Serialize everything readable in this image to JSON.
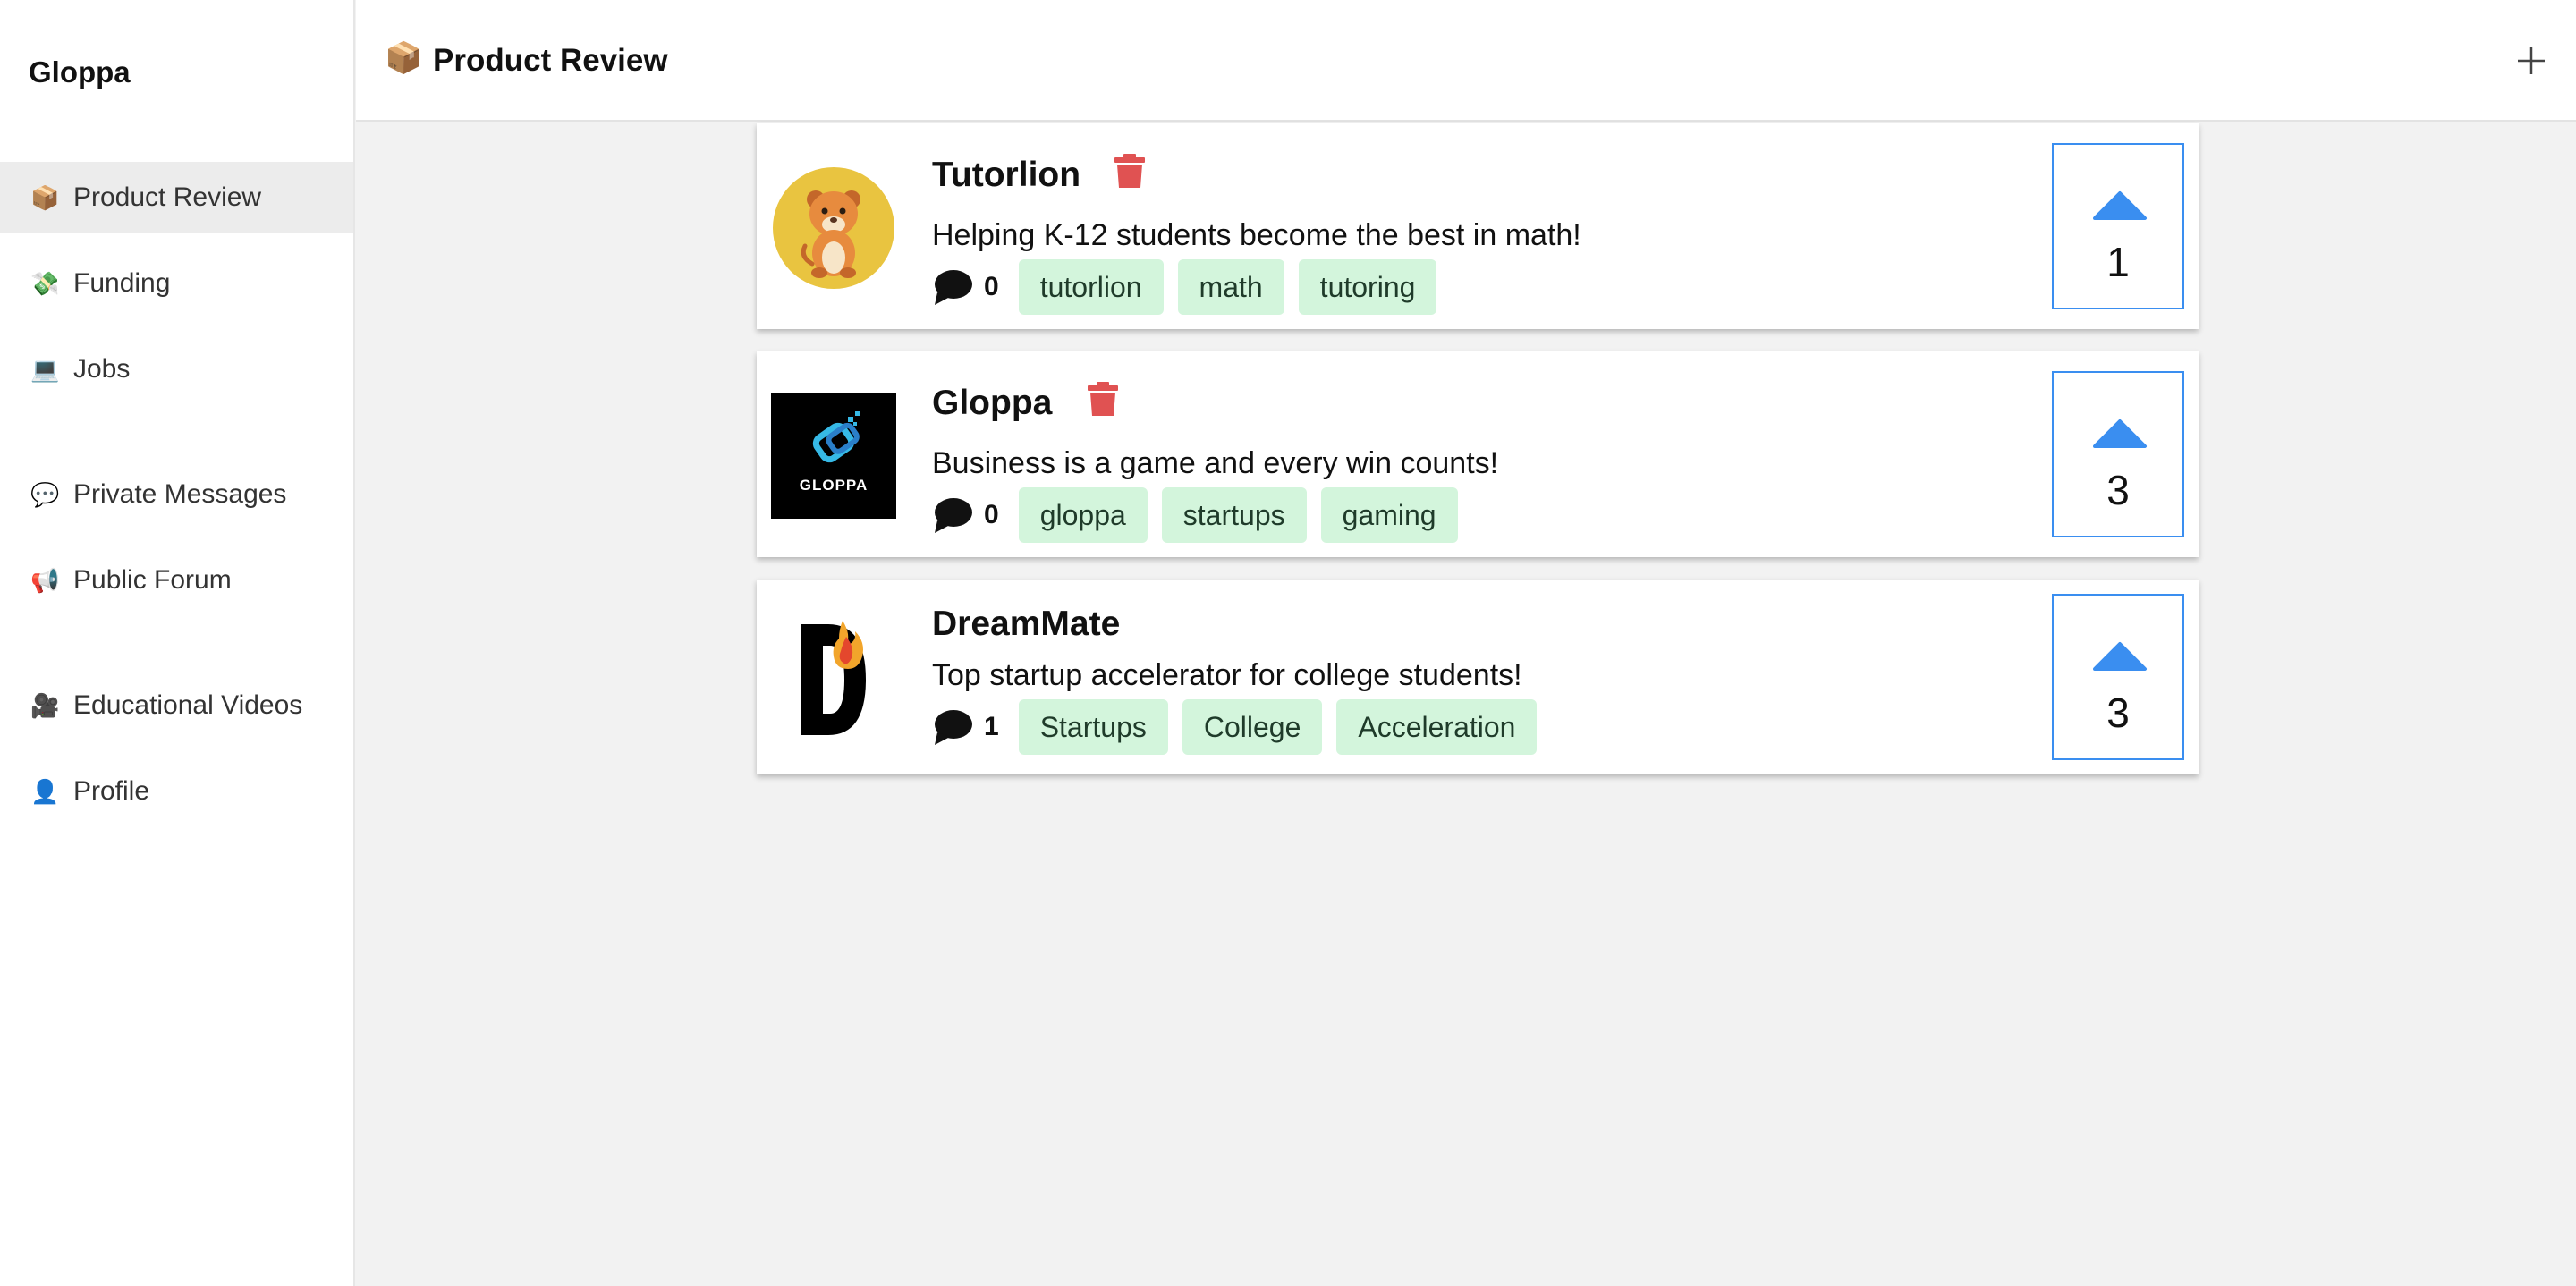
{
  "app": {
    "name": "Gloppa"
  },
  "sidebar": {
    "items": [
      {
        "emoji": "📦",
        "label": "Product Review",
        "active": true
      },
      {
        "emoji": "💸",
        "label": "Funding"
      },
      {
        "emoji": "💻",
        "label": "Jobs"
      },
      {
        "emoji": "💬",
        "label": "Private Messages"
      },
      {
        "emoji": "📢",
        "label": "Public Forum"
      },
      {
        "emoji": "🎥",
        "label": "Educational Videos"
      },
      {
        "emoji": "👤",
        "label": "Profile"
      }
    ]
  },
  "header": {
    "emoji": "📦",
    "title": "Product Review",
    "add_icon": "plus-icon"
  },
  "products": [
    {
      "name": "Tutorlion",
      "description": "Helping K-12 students become the best in math!",
      "comments": "0",
      "tags": [
        "tutorlion",
        "math",
        "tutoring"
      ],
      "votes": "1",
      "logo": "lion"
    },
    {
      "name": "Gloppa",
      "description": "Business is a game and every win counts!",
      "comments": "0",
      "tags": [
        "gloppa",
        "startups",
        "gaming"
      ],
      "votes": "3",
      "logo": "gloppa",
      "logo_text": "GLOPPA"
    },
    {
      "name": "DreamMate",
      "description": "Top startup accelerator for college students!",
      "comments": "1",
      "tags": [
        "Startups",
        "College",
        "Acceleration"
      ],
      "votes": "3",
      "logo": "dreammate"
    }
  ],
  "colors": {
    "accent": "#3a8ef0",
    "tag_bg": "#d3f5dc",
    "trash": "#e05252"
  }
}
